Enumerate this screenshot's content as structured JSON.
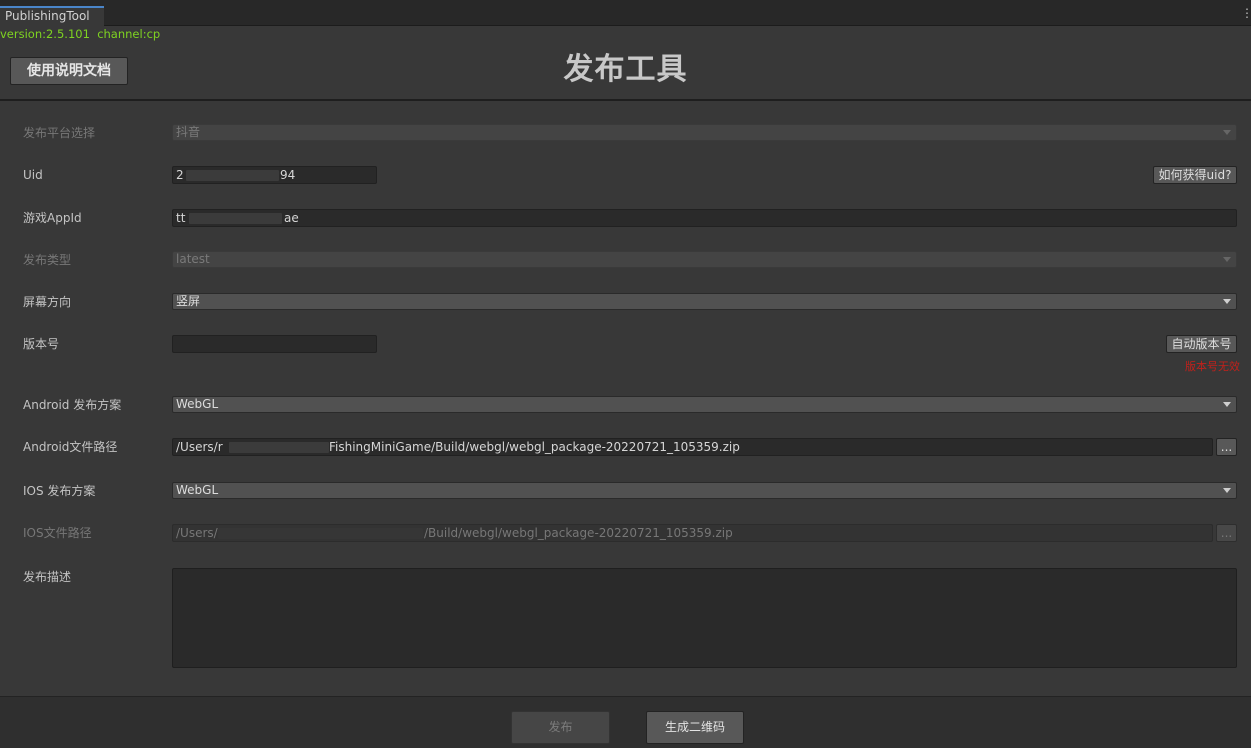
{
  "window": {
    "tab_title": "PublishingTool"
  },
  "version_line": "version:2.5.101  channel:cp",
  "header": {
    "doc_button": "使用说明文档",
    "title": "发布工具"
  },
  "form": {
    "platform": {
      "label": "发布平台选择",
      "value": "抖音"
    },
    "uid": {
      "label": "Uid",
      "value_start": "2",
      "value_end": "94",
      "help_button": "如何获得uid?"
    },
    "appid": {
      "label": "游戏AppId",
      "value_start": "tt",
      "value_end": "ae"
    },
    "publish_type": {
      "label": "发布类型",
      "value": "latest"
    },
    "orientation": {
      "label": "屏幕方向",
      "value": "竖屏"
    },
    "version": {
      "label": "版本号",
      "value": "",
      "auto_button": "自动版本号",
      "warning": "版本号无效"
    },
    "android_scheme": {
      "label": "Android 发布方案",
      "value": "WebGL"
    },
    "android_path": {
      "label": "Android文件路径",
      "value_start": "/Users/r",
      "value_end": "FishingMiniGame/Build/webgl/webgl_package-20220721_105359.zip",
      "browse_button": "..."
    },
    "ios_scheme": {
      "label": "IOS 发布方案",
      "value": "WebGL"
    },
    "ios_path": {
      "label": "IOS文件路径",
      "value_start": "/Users/",
      "value_end": "/Build/webgl/webgl_package-20220721_105359.zip",
      "browse_button": "..."
    },
    "description": {
      "label": "发布描述",
      "value": ""
    }
  },
  "footer": {
    "publish_button": "发布",
    "qr_button": "生成二维码"
  }
}
